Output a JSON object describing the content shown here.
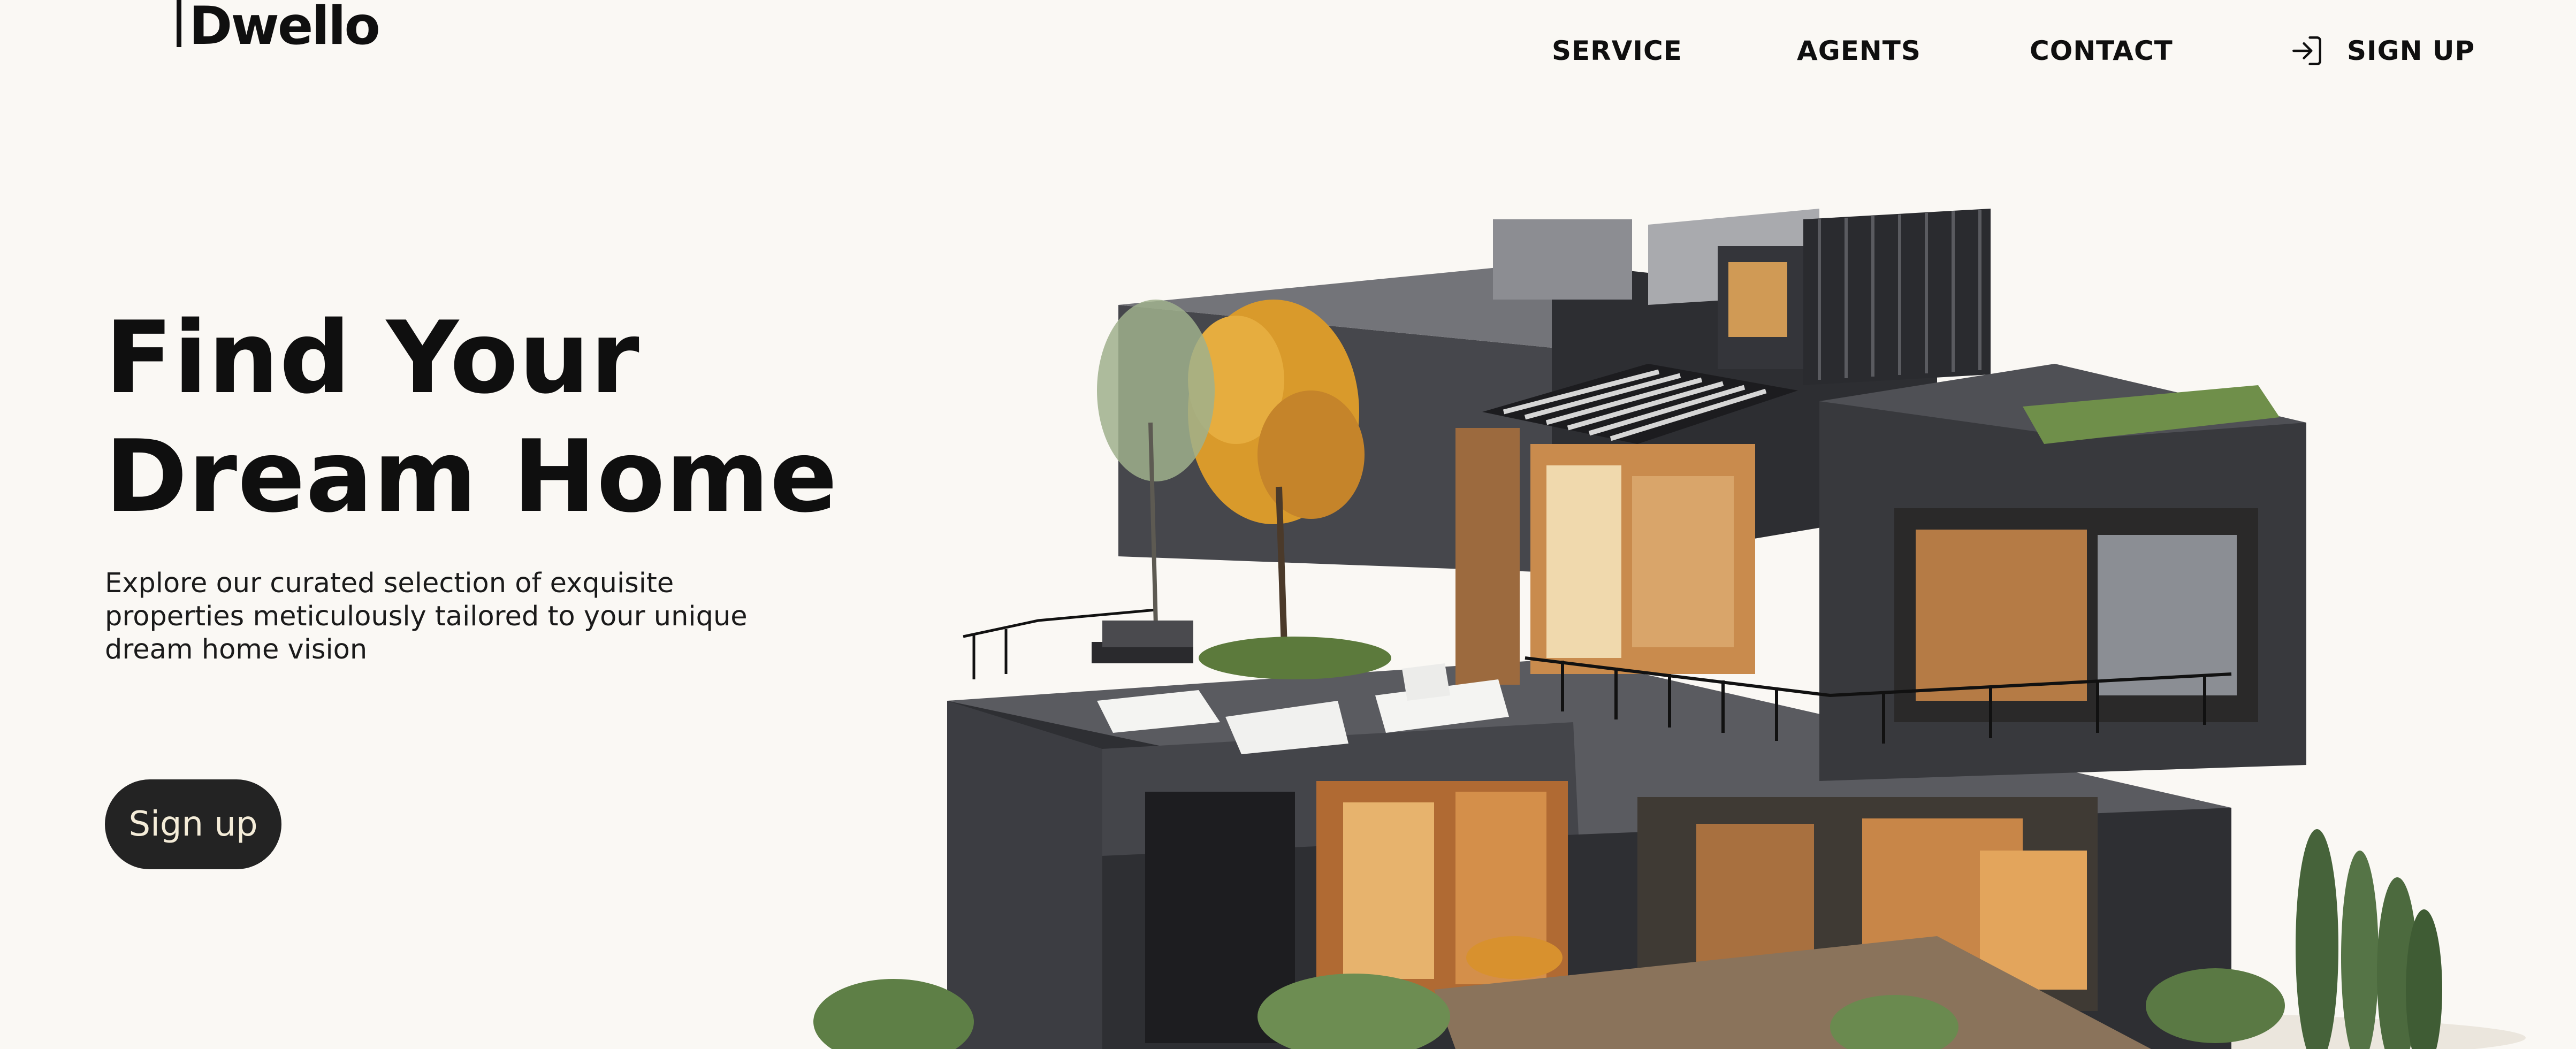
{
  "header": {
    "logo": "Dwello",
    "nav": [
      "SERVICE",
      "AGENTS",
      "CONTACT"
    ],
    "signup_label": "SIGN UP",
    "signup_icon": "sign-in-icon"
  },
  "hero": {
    "title_line1": "Find Your",
    "title_line2": "Dream Home",
    "subtitle_line1": "Explore our curated selection of exquisite",
    "subtitle_line2": "properties meticulously tailored to your unique",
    "subtitle_line3": "dream home vision",
    "cta_label": "Sign up"
  },
  "colors": {
    "background": "#faf8f4",
    "text": "#0f0f0f",
    "cta_bg": "#232323",
    "cta_text": "#f4ecd8",
    "house_dark": "#3a3b3f",
    "house_wood": "#c8834a",
    "foliage_orange": "#d99a2b",
    "foliage_green": "#5c7a3c"
  }
}
